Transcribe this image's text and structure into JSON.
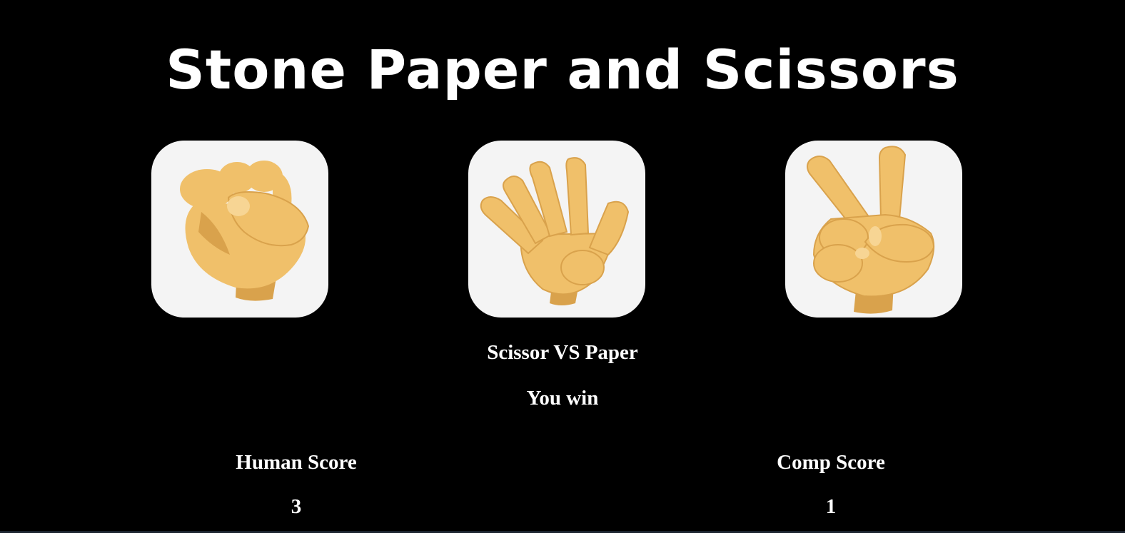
{
  "title": "Stone Paper and Scissors",
  "choices": [
    {
      "id": "stone",
      "icon": "fist-icon"
    },
    {
      "id": "paper",
      "icon": "open-hand-icon"
    },
    {
      "id": "scissors",
      "icon": "victory-hand-icon"
    }
  ],
  "round": {
    "matchup": "Scissor VS Paper",
    "result": "You win"
  },
  "scores": {
    "human_label": "Human Score",
    "human_value": "3",
    "comp_label": "Comp Score",
    "comp_value": "1"
  },
  "colors": {
    "background": "#000000",
    "text": "#ffffff",
    "card": "#f4f4f4",
    "skin": "#f0c06a",
    "skin_shadow": "#d9a24c"
  }
}
